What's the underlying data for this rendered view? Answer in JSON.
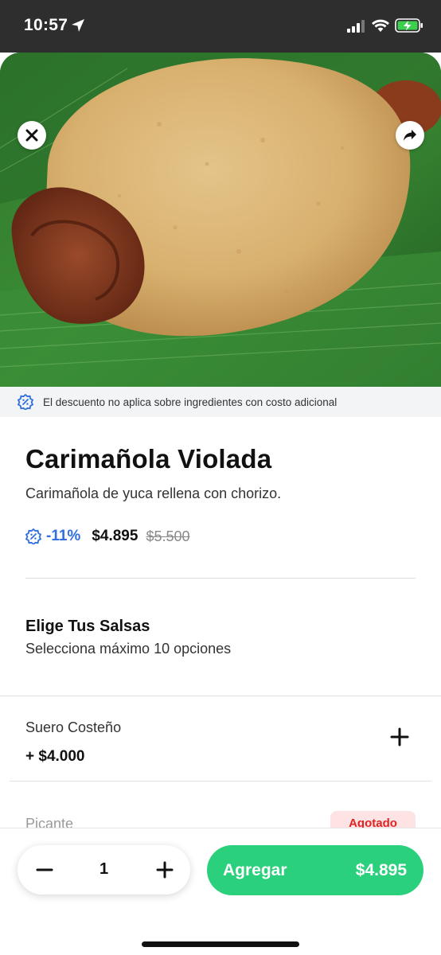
{
  "status_bar": {
    "time": "10:57"
  },
  "hero": {
    "image_subject": "carimañola with chorizo on banana leaf",
    "close_icon": "close-icon",
    "share_icon": "share-icon"
  },
  "notice": {
    "text": "El descuento no aplica sobre ingredientes con costo adicional"
  },
  "product": {
    "title": "Carimañola Violada",
    "description": "Carimañola de yuca rellena con chorizo.",
    "discount": "-11%",
    "price": "$4.895",
    "original_price": "$5.500"
  },
  "options_section": {
    "title": "Elige Tus Salsas",
    "subtitle": "Selecciona máximo 10 opciones",
    "items": [
      {
        "name": "Suero Costeño",
        "price": "+ $4.000"
      },
      {
        "name": "Picante",
        "status": "Agotado"
      }
    ]
  },
  "cart": {
    "quantity": "1",
    "add_label": "Agregar",
    "total": "$4.895"
  },
  "colors": {
    "accent_green": "#2ad07b",
    "discount_blue": "#2f6fe0",
    "sold_out_red": "#e02424",
    "status_bar": "#2e2e2e"
  }
}
